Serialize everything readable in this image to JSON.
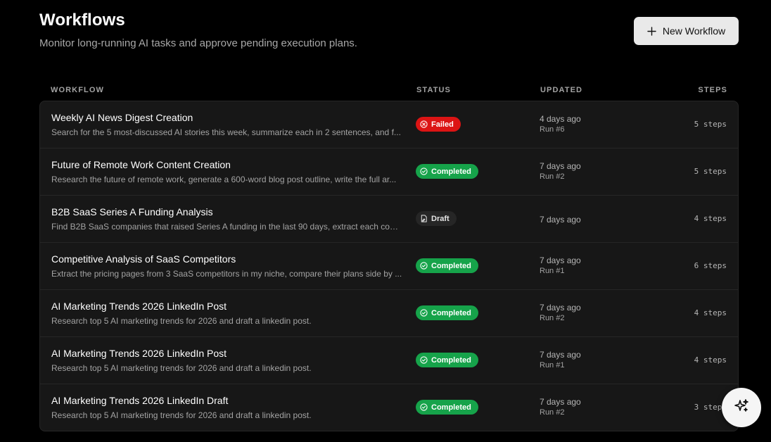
{
  "header": {
    "title": "Workflows",
    "subtitle": "Monitor long-running AI tasks and approve pending execution plans.",
    "new_button_label": "New Workflow",
    "new_button_icon": "plus-icon"
  },
  "table": {
    "columns": {
      "workflow": "WORKFLOW",
      "status": "STATUS",
      "updated": "UPDATED",
      "steps": "STEPS"
    },
    "rows": [
      {
        "title": "Weekly AI News Digest Creation",
        "description": "Search for the 5 most-discussed AI stories this week, summarize each in 2 sentences, and f...",
        "status": "Failed",
        "status_type": "failed",
        "updated": "4 days ago",
        "run": "Run #6",
        "steps": "5 steps"
      },
      {
        "title": "Future of Remote Work Content Creation",
        "description": "Research the future of remote work, generate a 600-word blog post outline, write the full ar...",
        "status": "Completed",
        "status_type": "completed",
        "updated": "7 days ago",
        "run": "Run #2",
        "steps": "5 steps"
      },
      {
        "title": "B2B SaaS Series A Funding Analysis",
        "description": "Find B2B SaaS companies that raised Series A funding in the last 90 days, extract each com...",
        "status": "Draft",
        "status_type": "draft",
        "updated": "7 days ago",
        "run": "",
        "steps": "4 steps"
      },
      {
        "title": "Competitive Analysis of SaaS Competitors",
        "description": "Extract the pricing pages from 3 SaaS competitors in my niche, compare their plans side by ...",
        "status": "Completed",
        "status_type": "completed",
        "updated": "7 days ago",
        "run": "Run #1",
        "steps": "6 steps"
      },
      {
        "title": "AI Marketing Trends 2026 LinkedIn Post",
        "description": "Research top 5 AI marketing trends for 2026 and draft a linkedin post.",
        "status": "Completed",
        "status_type": "completed",
        "updated": "7 days ago",
        "run": "Run #2",
        "steps": "4 steps"
      },
      {
        "title": "AI Marketing Trends 2026 LinkedIn Post",
        "description": "Research top 5 AI marketing trends for 2026 and draft a linkedin post.",
        "status": "Completed",
        "status_type": "completed",
        "updated": "7 days ago",
        "run": "Run #1",
        "steps": "4 steps"
      },
      {
        "title": "AI Marketing Trends 2026 LinkedIn Draft",
        "description": "Research top 5 AI marketing trends for 2026 and draft a linkedin post.",
        "status": "Completed",
        "status_type": "completed",
        "updated": "7 days ago",
        "run": "Run #2",
        "steps": "3 steps"
      }
    ]
  },
  "fab": {
    "icon": "sparkles-icon"
  },
  "colors": {
    "background": "#000000",
    "card": "#171717",
    "failed": "#dc1414",
    "completed": "#16a34a",
    "draft": "#262626",
    "button": "#e9e9e9"
  }
}
